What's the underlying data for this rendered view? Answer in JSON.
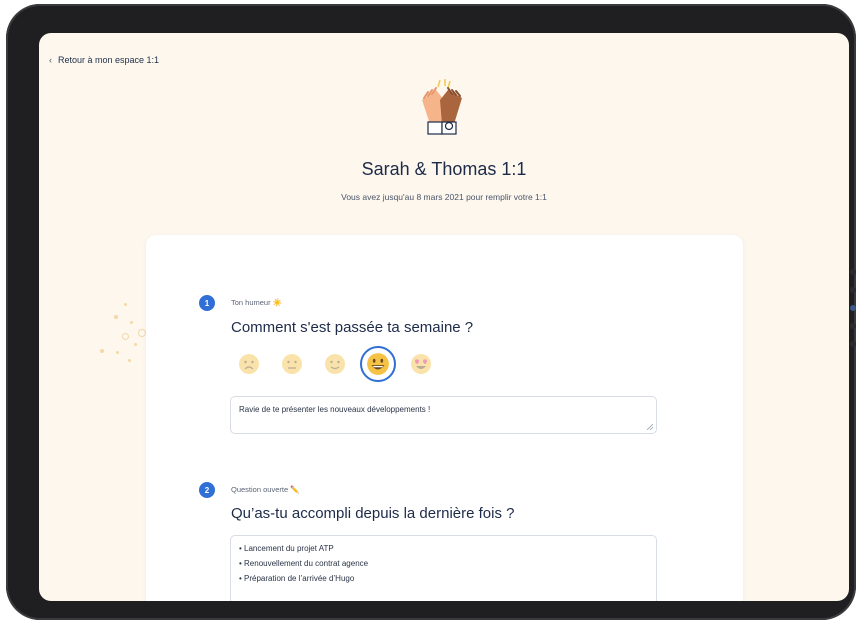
{
  "nav": {
    "back_label": "Retour à mon espace 1:1"
  },
  "header": {
    "title": "Sarah & Thomas 1:1",
    "subtitle": "Vous avez jusqu'au 8 mars 2021 pour remplir votre 1:1"
  },
  "questions": [
    {
      "number": "1",
      "label": "Ton humeur ☀️",
      "title": "Comment s'est passée ta semaine ?",
      "moods": [
        "sad",
        "neutral",
        "slight-smile",
        "grinning",
        "heart-eyes"
      ],
      "selected_mood": "grinning",
      "answer": "Ravie de te présenter les nouveaux développements !"
    },
    {
      "number": "2",
      "label": "Question ouverte ✏️",
      "title": "Qu’as-tu accompli depuis la dernière fois ?",
      "answer_lines": [
        "• Lancement du projet ATP",
        "• Renouvellement du contrat agence",
        "• Préparation de l’arrivée d’Hugo"
      ]
    }
  ],
  "colors": {
    "accent": "#2f6fd6",
    "background": "#fdf7ee",
    "text": "#1d2b48"
  }
}
